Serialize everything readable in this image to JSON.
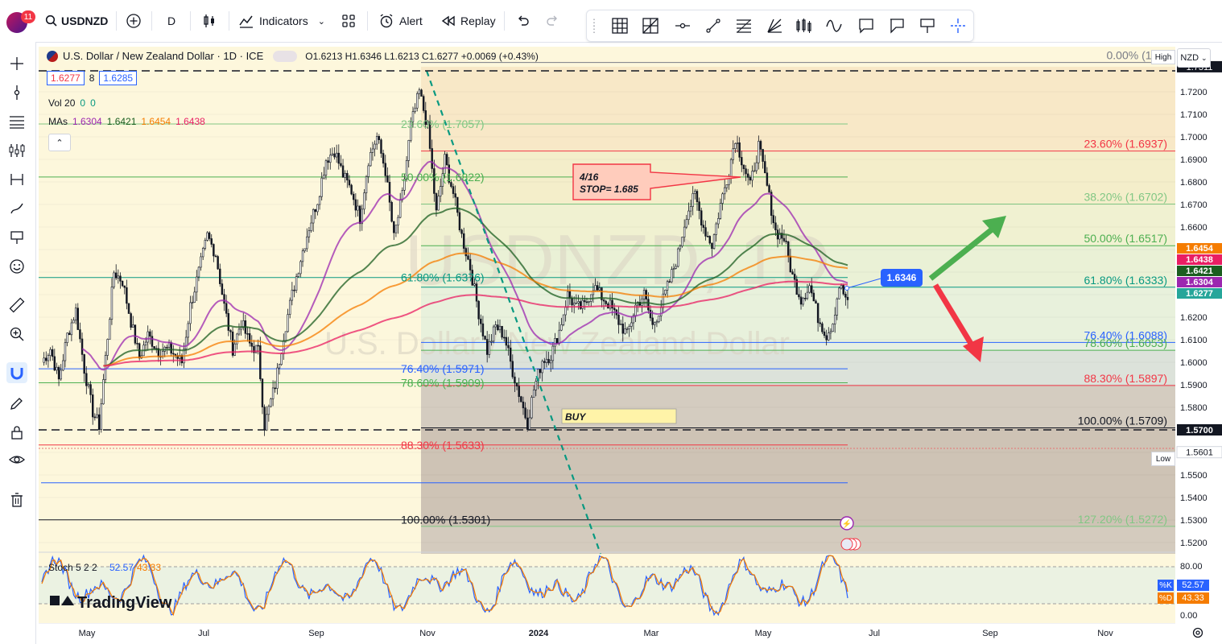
{
  "toolbar": {
    "notif_count": "11",
    "symbol": "USDNZD",
    "interval": "D",
    "indicators_label": "Indicators",
    "alert_label": "Alert",
    "replay_label": "Replay"
  },
  "legend": {
    "title": "U.S. Dollar / New Zealand Dollar · 1D · ICE",
    "ohlc": "O1.6213 H1.6346 L1.6213 C1.6277 +0.0069 (+0.43%)",
    "bid": "1.6277",
    "spread": "8",
    "ask": "1.6285",
    "vol_label": "Vol 20",
    "vol_v1": "0",
    "vol_v2": "0",
    "mas_label": "MAs",
    "ma1": "1.6304",
    "ma2": "1.6421",
    "ma3": "1.6454",
    "ma4": "1.6438"
  },
  "currency": "NZD",
  "branding": "TradingView",
  "watermark": {
    "big": "USDNZD, 1D",
    "small": "U.S. Dollar / New Zealand Dollar"
  },
  "annotations": {
    "stop_note_line1": "4/16",
    "stop_note_line2": "STOP= 1.685",
    "buy_label": "BUY",
    "price_tag": "1.6346"
  },
  "fib_right": [
    {
      "label": "0.00% (1.73",
      "value": 1.733,
      "color": "#787b86"
    },
    {
      "label": "23.60% (1.6937)",
      "value": 1.6937,
      "color": "#f23645"
    },
    {
      "label": "38.20% (1.6702)",
      "value": 1.6702,
      "color": "#81c784"
    },
    {
      "label": "50.00% (1.6517)",
      "value": 1.6517,
      "color": "#4caf50"
    },
    {
      "label": "61.80% (1.6333)",
      "value": 1.6333,
      "color": "#089981"
    },
    {
      "label": "76.40% (1.6088)",
      "value": 1.6088,
      "color": "#2962ff"
    },
    {
      "label": "78.60% (1.6053)",
      "value": 1.6053,
      "color": "#4caf50"
    },
    {
      "label": "88.30% (1.5897)",
      "value": 1.5897,
      "color": "#f23645"
    },
    {
      "label": "100.00% (1.5709)",
      "value": 1.5709,
      "color": "#131722"
    },
    {
      "label": "127.20% (1.5272)",
      "value": 1.5272,
      "color": "#81c784"
    }
  ],
  "fib_left": [
    {
      "label": "23.60% (1.7057)",
      "value": 1.7057,
      "color": "#81c784"
    },
    {
      "label": "50.00% (1.6822)",
      "value": 1.6822,
      "color": "#4caf50"
    },
    {
      "label": "61.80% (1.6376)",
      "value": 1.6376,
      "color": "#089981"
    },
    {
      "label": "76.40% (1.5971)",
      "value": 1.5971,
      "color": "#2962ff"
    },
    {
      "label": "78.60% (1.5909)",
      "value": 1.5909,
      "color": "#4caf50"
    },
    {
      "label": "88.30% (1.5633)",
      "value": 1.5633,
      "color": "#f23645"
    },
    {
      "label": "100.00% (1.5301)",
      "value": 1.5301,
      "color": "#131722"
    }
  ],
  "axis_badges": [
    {
      "label": "MAs:MMA100",
      "value": "1.6454",
      "color": "#f57c00"
    },
    {
      "label": "MAs:MMA200",
      "value": "1.6438",
      "color": "#e91e63"
    },
    {
      "label": "MAs:MMA50",
      "value": "1.6421",
      "color": "#1b5e20"
    },
    {
      "label": "MAs:MMA20",
      "value": "1.6304",
      "color": "#9c27b0"
    },
    {
      "label": "USDNZD",
      "value": "1.6277",
      "color": "#26a69a"
    }
  ],
  "high_label": "High",
  "high_value": "1.7311",
  "low_label": "Low",
  "low_value": "1.5601",
  "level_1570": "1.5700",
  "stoch": {
    "label": "Stoch 5 2 2",
    "k": "52.57",
    "d": "43.33",
    "k_label": "%K",
    "d_label": "%D",
    "ticks": [
      "80.00",
      "0.00"
    ]
  },
  "chart_data": {
    "type": "candlestick",
    "title": "U.S. Dollar / New Zealand Dollar · 1D · ICE",
    "ylim": [
      1.515,
      1.735
    ],
    "y_ticks": [
      "1.7200",
      "1.7100",
      "1.7000",
      "1.6900",
      "1.6800",
      "1.6700",
      "1.6600",
      "1.6500",
      "1.6400",
      "1.6300",
      "1.6200",
      "1.6100",
      "1.6000",
      "1.5900",
      "1.5800",
      "1.5700",
      "1.5600",
      "1.5500",
      "1.5400",
      "1.5300",
      "1.5200"
    ],
    "x_ticks": [
      "May",
      "Jul",
      "Sep",
      "Nov",
      "2024",
      "Mar",
      "May",
      "Jul",
      "Sep",
      "Nov"
    ],
    "close_path": [
      [
        0,
        1.6
      ],
      [
        4,
        1.606
      ],
      [
        8,
        1.592
      ],
      [
        12,
        1.612
      ],
      [
        16,
        1.623
      ],
      [
        20,
        1.597
      ],
      [
        24,
        1.578
      ],
      [
        27,
        1.572
      ],
      [
        30,
        1.602
      ],
      [
        34,
        1.64
      ],
      [
        38,
        1.636
      ],
      [
        42,
        1.618
      ],
      [
        46,
        1.602
      ],
      [
        50,
        1.612
      ],
      [
        55,
        1.605
      ],
      [
        60,
        1.606
      ],
      [
        66,
        1.6
      ],
      [
        70,
        1.625
      ],
      [
        74,
        1.64
      ],
      [
        78,
        1.656
      ],
      [
        82,
        1.648
      ],
      [
        86,
        1.625
      ],
      [
        90,
        1.606
      ],
      [
        94,
        1.618
      ],
      [
        98,
        1.608
      ],
      [
        102,
        1.605
      ],
      [
        105,
        1.572
      ],
      [
        110,
        1.59
      ],
      [
        114,
        1.612
      ],
      [
        118,
        1.63
      ],
      [
        122,
        1.646
      ],
      [
        126,
        1.66
      ],
      [
        130,
        1.672
      ],
      [
        134,
        1.69
      ],
      [
        138,
        1.694
      ],
      [
        142,
        1.683
      ],
      [
        146,
        1.676
      ],
      [
        150,
        1.664
      ],
      [
        154,
        1.69
      ],
      [
        158,
        1.7
      ],
      [
        162,
        1.685
      ],
      [
        166,
        1.655
      ],
      [
        170,
        1.674
      ],
      [
        174,
        1.705
      ],
      [
        178,
        1.72
      ],
      [
        182,
        1.704
      ],
      [
        186,
        1.666
      ],
      [
        190,
        1.69
      ],
      [
        194,
        1.675
      ],
      [
        198,
        1.656
      ],
      [
        202,
        1.642
      ],
      [
        206,
        1.622
      ],
      [
        210,
        1.605
      ],
      [
        214,
        1.616
      ],
      [
        218,
        1.612
      ],
      [
        222,
        1.596
      ],
      [
        226,
        1.583
      ],
      [
        229,
        1.573
      ],
      [
        232,
        1.588
      ],
      [
        236,
        1.601
      ],
      [
        240,
        1.603
      ],
      [
        244,
        1.614
      ],
      [
        248,
        1.63
      ],
      [
        252,
        1.624
      ],
      [
        256,
        1.625
      ],
      [
        260,
        1.634
      ],
      [
        264,
        1.629
      ],
      [
        268,
        1.625
      ],
      [
        272,
        1.618
      ],
      [
        276,
        1.612
      ],
      [
        280,
        1.625
      ],
      [
        284,
        1.63
      ],
      [
        288,
        1.616
      ],
      [
        292,
        1.625
      ],
      [
        296,
        1.636
      ],
      [
        300,
        1.648
      ],
      [
        304,
        1.666
      ],
      [
        308,
        1.674
      ],
      [
        312,
        1.66
      ],
      [
        316,
        1.652
      ],
      [
        320,
        1.67
      ],
      [
        324,
        1.685
      ],
      [
        327,
        1.7
      ],
      [
        330,
        1.69
      ],
      [
        334,
        1.678
      ],
      [
        338,
        1.696
      ],
      [
        342,
        1.678
      ],
      [
        346,
        1.658
      ],
      [
        350,
        1.655
      ],
      [
        354,
        1.638
      ],
      [
        358,
        1.628
      ],
      [
        362,
        1.634
      ],
      [
        366,
        1.62
      ],
      [
        370,
        1.612
      ],
      [
        373,
        1.618
      ],
      [
        376,
        1.634
      ],
      [
        380,
        1.627
      ]
    ],
    "ma_series": [
      {
        "name": "MMA20",
        "color": "#9c27b0",
        "last": 1.6304
      },
      {
        "name": "MMA50",
        "color": "#1b5e20",
        "last": 1.6421
      },
      {
        "name": "MMA100",
        "color": "#f57c00",
        "last": 1.6454
      },
      {
        "name": "MMA200",
        "color": "#e91e63",
        "last": 1.6438
      }
    ],
    "last_close": 1.6277,
    "stop": 1.685
  }
}
